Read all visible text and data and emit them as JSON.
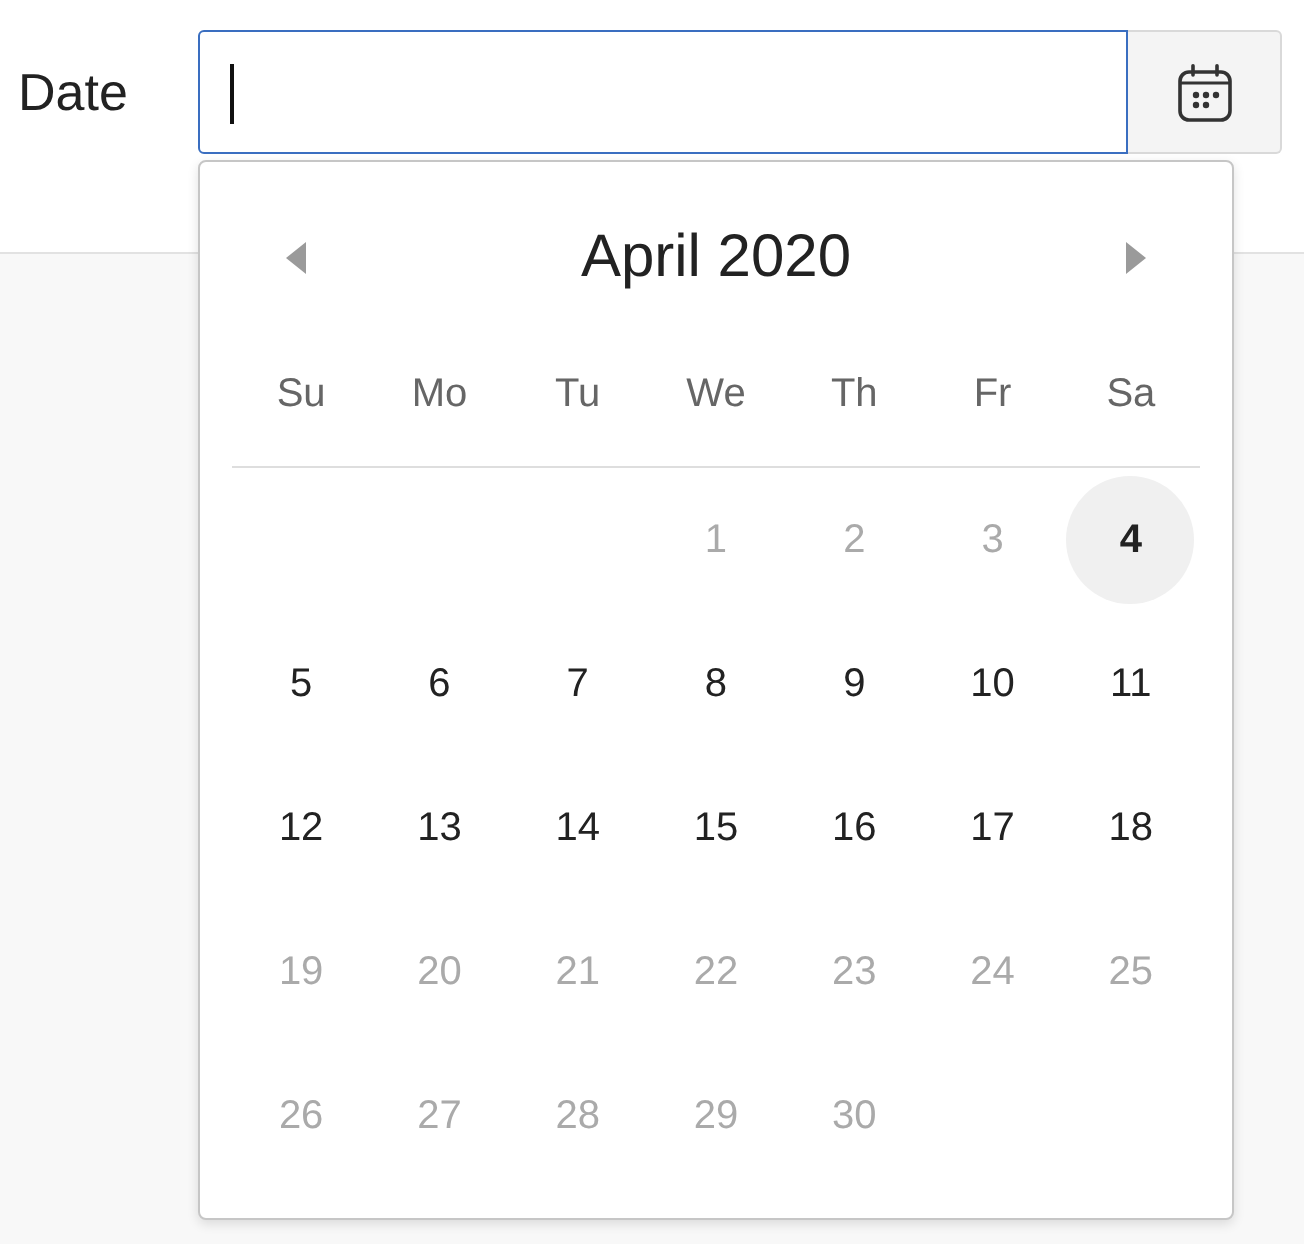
{
  "form": {
    "label": "Date",
    "date_field": {
      "focused": true
    }
  },
  "datepicker": {
    "month_title": "April 2020",
    "weekdays": [
      "Su",
      "Mo",
      "Tu",
      "We",
      "Th",
      "Fr",
      "Sa"
    ],
    "weeks": [
      [
        {
          "kind": "blank"
        },
        {
          "kind": "blank"
        },
        {
          "kind": "blank"
        },
        {
          "kind": "day",
          "label": "1",
          "disabled": true,
          "selected": false
        },
        {
          "kind": "day",
          "label": "2",
          "disabled": true,
          "selected": false
        },
        {
          "kind": "day",
          "label": "3",
          "disabled": true,
          "selected": false
        },
        {
          "kind": "day",
          "label": "4",
          "disabled": false,
          "selected": true
        }
      ],
      [
        {
          "kind": "day",
          "label": "5",
          "disabled": false,
          "selected": false
        },
        {
          "kind": "day",
          "label": "6",
          "disabled": false,
          "selected": false
        },
        {
          "kind": "day",
          "label": "7",
          "disabled": false,
          "selected": false
        },
        {
          "kind": "day",
          "label": "8",
          "disabled": false,
          "selected": false
        },
        {
          "kind": "day",
          "label": "9",
          "disabled": false,
          "selected": false
        },
        {
          "kind": "day",
          "label": "10",
          "disabled": false,
          "selected": false
        },
        {
          "kind": "day",
          "label": "11",
          "disabled": false,
          "selected": false
        }
      ],
      [
        {
          "kind": "day",
          "label": "12",
          "disabled": false,
          "selected": false
        },
        {
          "kind": "day",
          "label": "13",
          "disabled": false,
          "selected": false
        },
        {
          "kind": "day",
          "label": "14",
          "disabled": false,
          "selected": false
        },
        {
          "kind": "day",
          "label": "15",
          "disabled": false,
          "selected": false
        },
        {
          "kind": "day",
          "label": "16",
          "disabled": false,
          "selected": false
        },
        {
          "kind": "day",
          "label": "17",
          "disabled": false,
          "selected": false
        },
        {
          "kind": "day",
          "label": "18",
          "disabled": false,
          "selected": false
        }
      ],
      [
        {
          "kind": "day",
          "label": "19",
          "disabled": true,
          "selected": false
        },
        {
          "kind": "day",
          "label": "20",
          "disabled": true,
          "selected": false
        },
        {
          "kind": "day",
          "label": "21",
          "disabled": true,
          "selected": false
        },
        {
          "kind": "day",
          "label": "22",
          "disabled": true,
          "selected": false
        },
        {
          "kind": "day",
          "label": "23",
          "disabled": true,
          "selected": false
        },
        {
          "kind": "day",
          "label": "24",
          "disabled": true,
          "selected": false
        },
        {
          "kind": "day",
          "label": "25",
          "disabled": true,
          "selected": false
        }
      ],
      [
        {
          "kind": "day",
          "label": "26",
          "disabled": true,
          "selected": false
        },
        {
          "kind": "day",
          "label": "27",
          "disabled": true,
          "selected": false
        },
        {
          "kind": "day",
          "label": "28",
          "disabled": true,
          "selected": false
        },
        {
          "kind": "day",
          "label": "29",
          "disabled": true,
          "selected": false
        },
        {
          "kind": "day",
          "label": "30",
          "disabled": true,
          "selected": false
        },
        {
          "kind": "blank"
        },
        {
          "kind": "blank"
        }
      ]
    ]
  }
}
